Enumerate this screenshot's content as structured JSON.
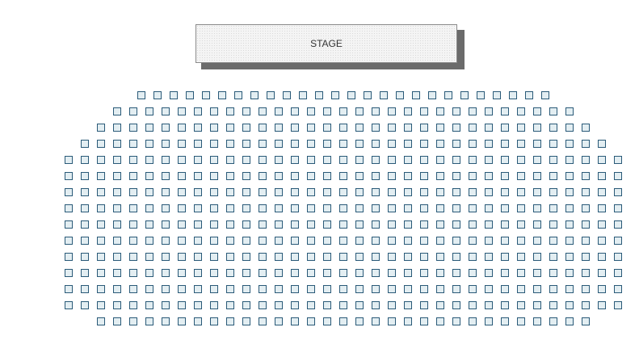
{
  "stage": {
    "label": "STAGE"
  },
  "colors": {
    "seat_border": "#2a5a78",
    "seat_fill": "#e3eef2",
    "stage_shadow": "#6b6b6b"
  },
  "rows": [
    {
      "seats": 26
    },
    {
      "seats": 29
    },
    {
      "seats": 31
    },
    {
      "seats": 33
    },
    {
      "seats": 35
    },
    {
      "seats": 35
    },
    {
      "seats": 35
    },
    {
      "seats": 35
    },
    {
      "seats": 35
    },
    {
      "seats": 35
    },
    {
      "seats": 35
    },
    {
      "seats": 35
    },
    {
      "seats": 35
    },
    {
      "seats": 35
    },
    {
      "seats": 31
    }
  ]
}
